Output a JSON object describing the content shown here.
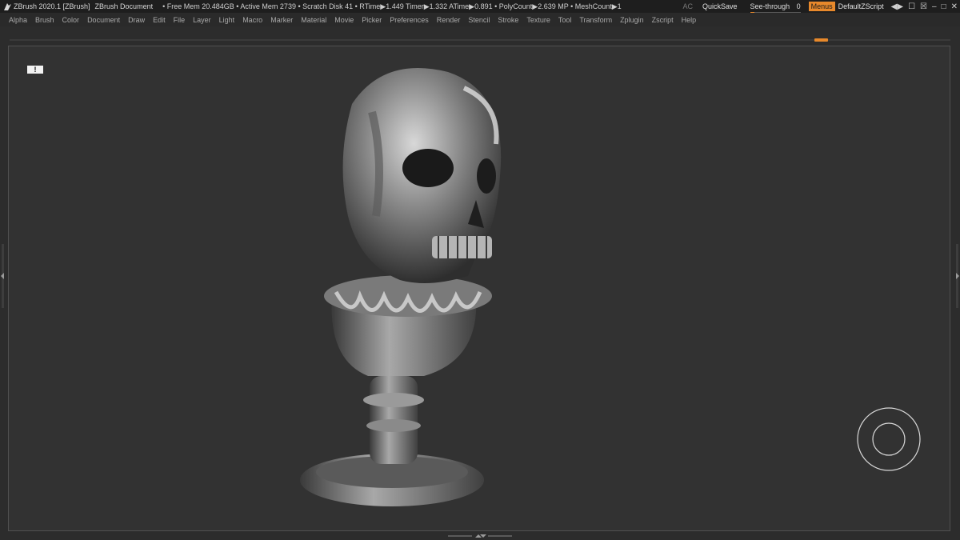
{
  "titlebar": {
    "app_title": "ZBrush 2020.1 [ZBrush]",
    "document": "ZBrush Document",
    "status_line": "• Free Mem 20.484GB • Active Mem 2739 • Scratch Disk 41 •  RTime▶1.449 Timer▶1.332 ATime▶0.891 • PolyCount▶2.639 MP • MeshCount▶1",
    "ac": "AC",
    "quicksave": "QuickSave",
    "see_through_label": "See-through",
    "see_through_value": "0",
    "see_through_level": 0,
    "menus": "Menus",
    "default_zscript": "DefaultZScript",
    "controls": [
      "◀▶",
      "☐",
      "☒",
      "–",
      "□",
      "✕"
    ]
  },
  "menubar": {
    "items": [
      "Alpha",
      "Brush",
      "Color",
      "Document",
      "Draw",
      "Edit",
      "File",
      "Layer",
      "Light",
      "Macro",
      "Marker",
      "Material",
      "Movie",
      "Picker",
      "Preferences",
      "Render",
      "Stencil",
      "Stroke",
      "Texture",
      "Tool",
      "Transform",
      "Zplugin",
      "Zscript",
      "Help"
    ]
  },
  "canvas": {
    "notice": "!"
  },
  "colors": {
    "accent": "#e8892b",
    "background": "#2c2c2c",
    "canvas": "#323232",
    "titlebar": "#1e1e1e"
  },
  "icons": {
    "logo": "zbrush-logo-icon",
    "gizmo": "navigation-gizmo-icon"
  }
}
